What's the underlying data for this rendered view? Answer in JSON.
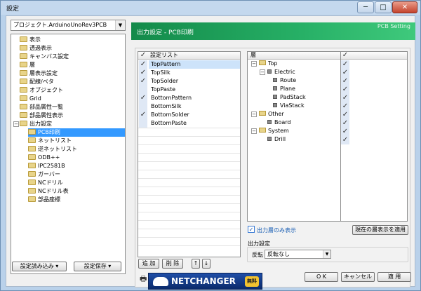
{
  "window": {
    "title": "設定",
    "min": "─",
    "max": "□",
    "close": "✕"
  },
  "project_combo": {
    "value": "プロジェクト.ArduinoUnoRev3PCB",
    "arrow": "▼"
  },
  "tree": {
    "items": [
      {
        "label": "表示"
      },
      {
        "label": "透過表示"
      },
      {
        "label": "キャンバス設定"
      },
      {
        "label": "層"
      },
      {
        "label": "層表示設定"
      },
      {
        "label": "配線/ベタ"
      },
      {
        "label": "オブジェクト"
      },
      {
        "label": "Grid"
      },
      {
        "label": "部品属性一覧"
      },
      {
        "label": "部品属性表示"
      },
      {
        "label": "出力設定"
      }
    ],
    "expand": "−",
    "children": [
      {
        "label": "PCB印刷"
      },
      {
        "label": "ネットリスト"
      },
      {
        "label": "逆ネットリスト"
      },
      {
        "label": "ODB++"
      },
      {
        "label": "IPC2581B"
      },
      {
        "label": "ガーバー"
      },
      {
        "label": "NCドリル"
      },
      {
        "label": "NCドリル表"
      },
      {
        "label": "部品座標"
      }
    ]
  },
  "left_buttons": {
    "load": "設定読み込み ▾",
    "save": "設定保存 ▾"
  },
  "banner": {
    "title": "出力設定 - PCB印刷",
    "right": "PCB Setting"
  },
  "settings_list": {
    "header_check": "✓",
    "header": "設定リスト",
    "rows": [
      {
        "label": "TopPattern",
        "mark": "✓"
      },
      {
        "label": "TopSilk",
        "mark": "✓"
      },
      {
        "label": "TopSolder",
        "mark": "✓"
      },
      {
        "label": "TopPaste",
        "mark": ""
      },
      {
        "label": "BottomPattern",
        "mark": "✓"
      },
      {
        "label": "BottomSilk",
        "mark": ""
      },
      {
        "label": "BottomSolder",
        "mark": "✓"
      },
      {
        "label": "BottomPaste",
        "mark": ""
      }
    ]
  },
  "list_buttons": {
    "add": "追 加",
    "delete": "削 除",
    "up": "↑",
    "down": "↓"
  },
  "layers": {
    "header": "層",
    "header_check": "✓",
    "rows": [
      {
        "label": "Top",
        "mark": "✓"
      },
      {
        "label": "Electric",
        "mark": "✓"
      },
      {
        "label": "Route",
        "mark": "✓"
      },
      {
        "label": "Plane",
        "mark": "✓"
      },
      {
        "label": "PadStack",
        "mark": "✓"
      },
      {
        "label": "ViaStack",
        "mark": "✓"
      },
      {
        "label": "Other",
        "mark": "✓"
      },
      {
        "label": "Board",
        "mark": "✓"
      },
      {
        "label": "System",
        "mark": "✓"
      },
      {
        "label": "Drill",
        "mark": "✓"
      }
    ],
    "minus": "−"
  },
  "output_only": {
    "check": "✓",
    "label": "出力層のみ表示"
  },
  "apply_current": {
    "label": "現在の層表示を適用"
  },
  "output_settings": {
    "title": "出力設定",
    "invert_label": "反転",
    "invert_value": "反転なし",
    "arrow": "▼"
  },
  "printer_icon": "🖶",
  "logo": {
    "text": "NETCHANGER",
    "badge": "無料"
  },
  "dialog_buttons": {
    "ok": "O K",
    "cancel": "キャンセル",
    "apply": "適 用"
  },
  "colors": {
    "accent": "#27b066",
    "selection": "#3399ff"
  }
}
